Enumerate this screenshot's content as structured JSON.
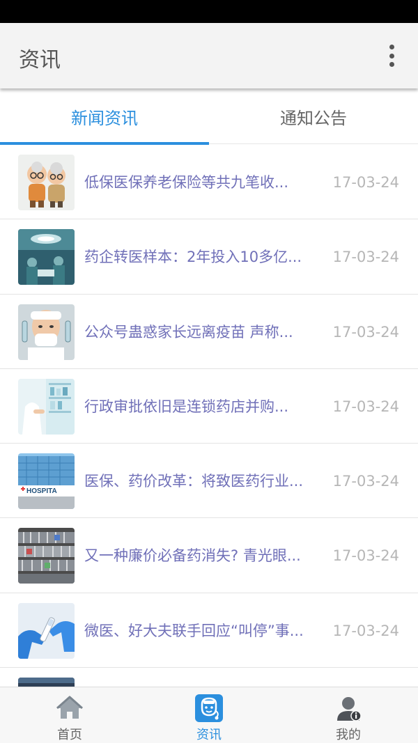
{
  "app_bar": {
    "title": "资讯",
    "menu_icon": "more-vert-icon"
  },
  "tabs": [
    {
      "label": "新闻资讯",
      "active": true
    },
    {
      "label": "通知公告",
      "active": false
    }
  ],
  "news": [
    {
      "title": "低保医保养老保险等共九笔收...",
      "date": "17-03-24",
      "thumb": "elderly-couple"
    },
    {
      "title": "药企转医样本：2年投入10多亿...",
      "date": "17-03-24",
      "thumb": "operating-room"
    },
    {
      "title": "公众号蛊惑家长远离疫苗 声称...",
      "date": "17-03-24",
      "thumb": "doctor-vaccine"
    },
    {
      "title": "行政审批依旧是连锁药店并购...",
      "date": "17-03-24",
      "thumb": "pharmacy-shelf"
    },
    {
      "title": "医保、药价改革：将致医药行业...",
      "date": "17-03-24",
      "thumb": "hospital-building"
    },
    {
      "title": "又一种廉价必备药消失? 青光眼...",
      "date": "17-03-24",
      "thumb": "drug-shelves"
    },
    {
      "title": "微医、好大夫联手回应“叫停”事...",
      "date": "17-03-24",
      "thumb": "gloved-hands"
    }
  ],
  "thumb_text": {
    "hospital_sign": "HOSPITA"
  },
  "bottom_nav": [
    {
      "label": "首页",
      "icon": "home-icon",
      "active": false
    },
    {
      "label": "资讯",
      "icon": "doctor-icon",
      "active": true
    },
    {
      "label": "我的",
      "icon": "user-icon",
      "active": false
    }
  ],
  "colors": {
    "accent": "#2b8fde",
    "title_text": "#7070b8",
    "date_text": "#b6b6b6",
    "app_bar": "#f3f3f3"
  }
}
